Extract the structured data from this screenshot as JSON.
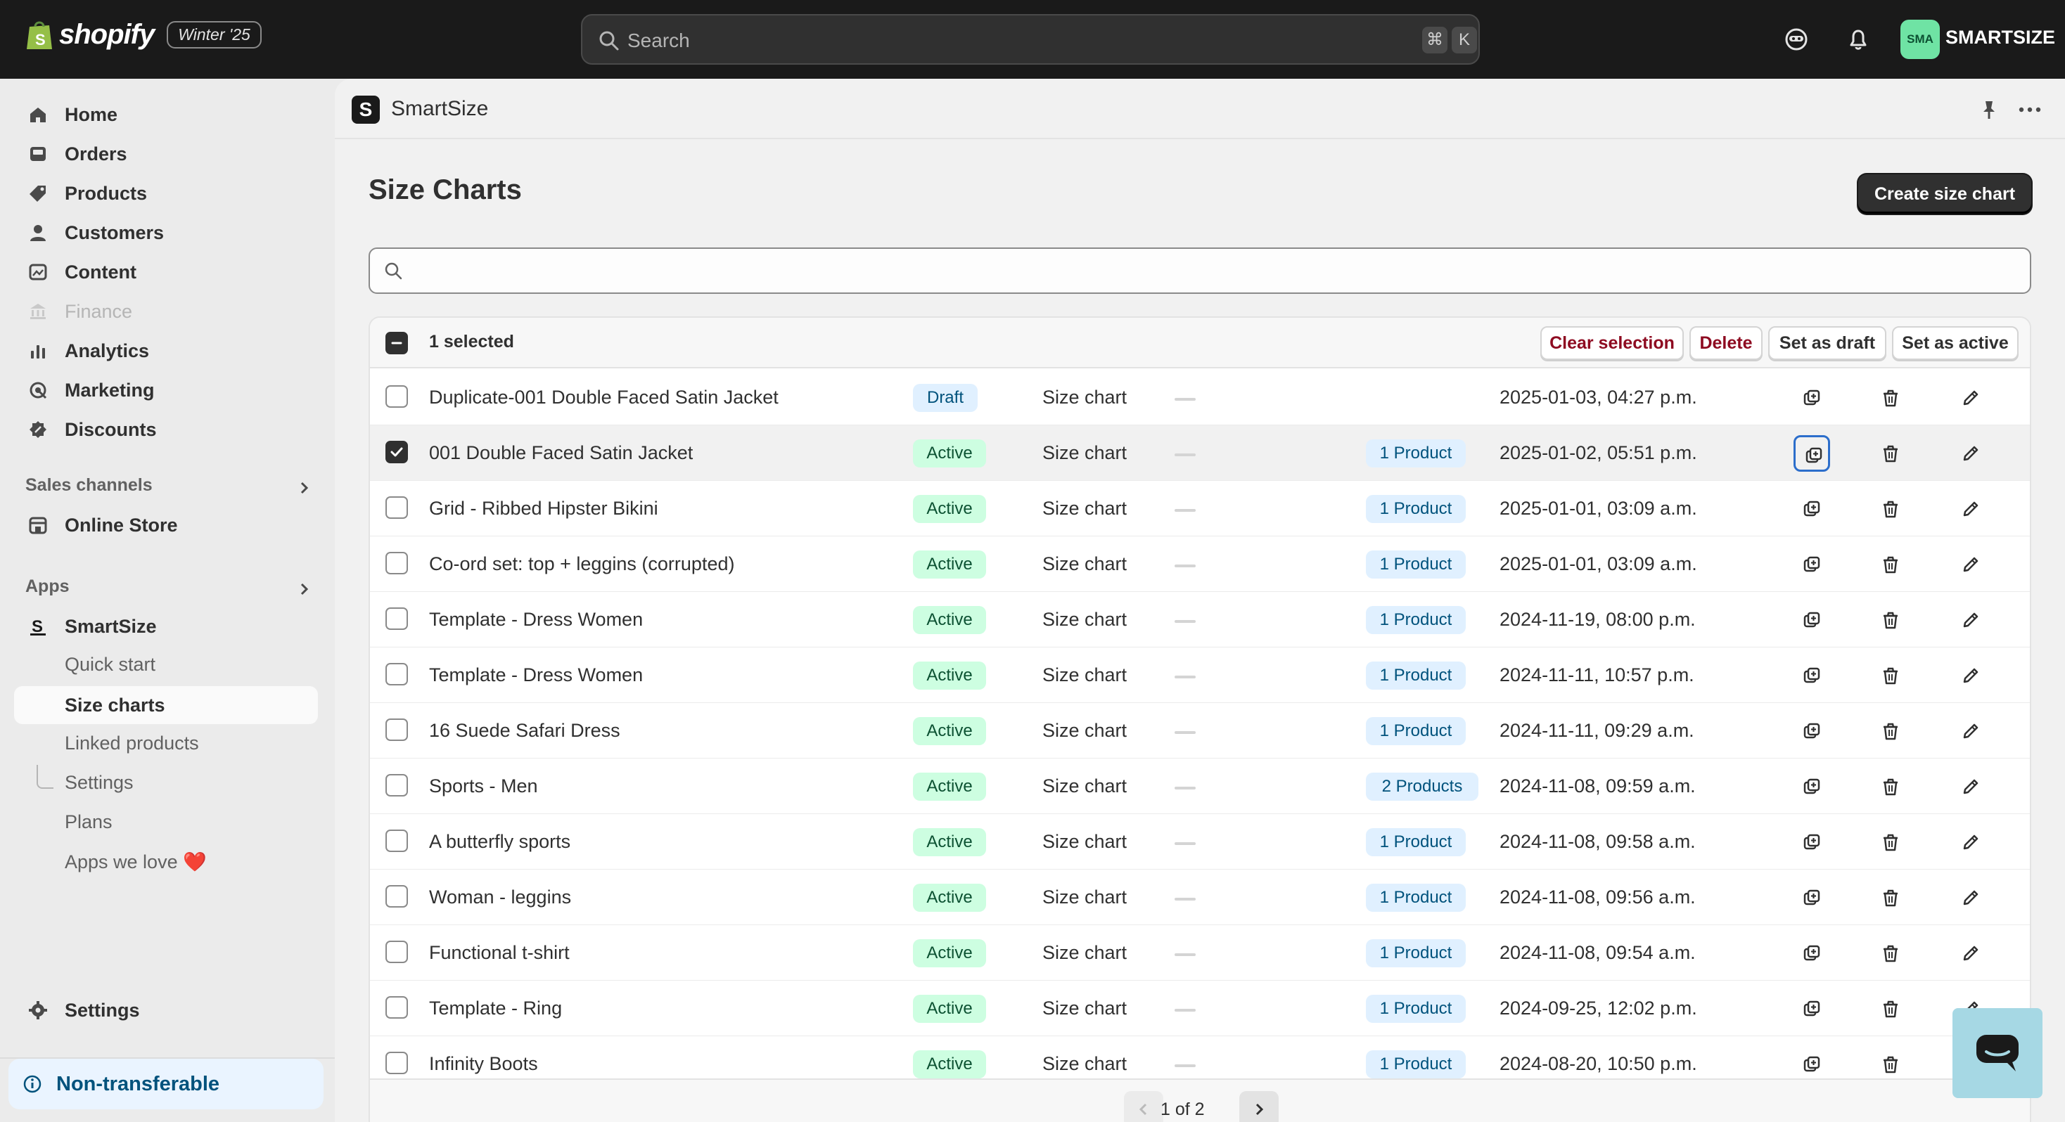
{
  "topbar": {
    "brand": "shopify",
    "edition": "Winter '25",
    "search_placeholder": "Search",
    "shortcut_cmd": "⌘",
    "shortcut_key": "K",
    "avatar_initials": "SMA",
    "store_name": "SMARTSIZE"
  },
  "sidebar": {
    "items": [
      {
        "label": "Home",
        "icon": "home-icon"
      },
      {
        "label": "Orders",
        "icon": "orders-icon"
      },
      {
        "label": "Products",
        "icon": "tag-icon"
      },
      {
        "label": "Customers",
        "icon": "person-icon"
      },
      {
        "label": "Content",
        "icon": "content-icon"
      },
      {
        "label": "Finance",
        "icon": "bank-icon",
        "disabled": true
      },
      {
        "label": "Analytics",
        "icon": "chart-icon"
      },
      {
        "label": "Marketing",
        "icon": "target-icon"
      },
      {
        "label": "Discounts",
        "icon": "discount-icon"
      }
    ],
    "sales_channels_title": "Sales channels",
    "online_store": "Online Store",
    "apps_title": "Apps",
    "app_name": "SmartSize",
    "app_subitems": [
      "Quick start",
      "Size charts",
      "Linked products",
      "Settings",
      "Plans",
      "Apps we love ❤️"
    ],
    "settings": "Settings",
    "non_transferable": "Non-transferable"
  },
  "app_header": {
    "logo_letter": "S",
    "title": "SmartSize"
  },
  "page": {
    "title": "Size Charts",
    "create_button": "Create size chart"
  },
  "bulk": {
    "selected_text": "1 selected",
    "clear_selection": "Clear selection",
    "delete": "Delete",
    "set_as_draft": "Set as draft",
    "set_as_active": "Set as active"
  },
  "rows": [
    {
      "name": "Duplicate-001 Double Faced Satin Jacket",
      "status": "Draft",
      "type": "Size chart",
      "products": "",
      "date": "2025-01-03, 04:27 p.m.",
      "checked": false
    },
    {
      "name": "001 Double Faced Satin Jacket",
      "status": "Active",
      "type": "Size chart",
      "products": "1 Product",
      "date": "2025-01-02, 05:51 p.m.",
      "checked": true
    },
    {
      "name": "Grid - Ribbed Hipster Bikini",
      "status": "Active",
      "type": "Size chart",
      "products": "1 Product",
      "date": "2025-01-01, 03:09 a.m.",
      "checked": false
    },
    {
      "name": "Co-ord set: top + leggins (corrupted)",
      "status": "Active",
      "type": "Size chart",
      "products": "1 Product",
      "date": "2025-01-01, 03:09 a.m.",
      "checked": false
    },
    {
      "name": "Template - Dress Women",
      "status": "Active",
      "type": "Size chart",
      "products": "1 Product",
      "date": "2024-11-19, 08:00 p.m.",
      "checked": false
    },
    {
      "name": "Template - Dress Women",
      "status": "Active",
      "type": "Size chart",
      "products": "1 Product",
      "date": "2024-11-11, 10:57 p.m.",
      "checked": false
    },
    {
      "name": "16 Suede Safari Dress",
      "status": "Active",
      "type": "Size chart",
      "products": "1 Product",
      "date": "2024-11-11, 09:29 a.m.",
      "checked": false
    },
    {
      "name": "Sports - Men",
      "status": "Active",
      "type": "Size chart",
      "products": "2 Products",
      "date": "2024-11-08, 09:59 a.m.",
      "checked": false
    },
    {
      "name": "A butterfly sports",
      "status": "Active",
      "type": "Size chart",
      "products": "1 Product",
      "date": "2024-11-08, 09:58 a.m.",
      "checked": false
    },
    {
      "name": "Woman - leggins",
      "status": "Active",
      "type": "Size chart",
      "products": "1 Product",
      "date": "2024-11-08, 09:56 a.m.",
      "checked": false
    },
    {
      "name": "Functional t-shirt",
      "status": "Active",
      "type": "Size chart",
      "products": "1 Product",
      "date": "2024-11-08, 09:54 a.m.",
      "checked": false
    },
    {
      "name": "Template - Ring",
      "status": "Active",
      "type": "Size chart",
      "products": "1 Product",
      "date": "2024-09-25, 12:02 p.m.",
      "checked": false
    },
    {
      "name": "Infinity Boots",
      "status": "Active",
      "type": "Size chart",
      "products": "1 Product",
      "date": "2024-08-20, 10:50 p.m.",
      "checked": false
    }
  ],
  "pagination": {
    "label": "1 of 2"
  },
  "colors": {
    "topbar": "#1a1a1a",
    "active_badge": "#cdfee1",
    "draft_badge": "#e0f0ff",
    "focus_ring": "#2c6ecb",
    "chat_button": "#a6d8e4"
  }
}
